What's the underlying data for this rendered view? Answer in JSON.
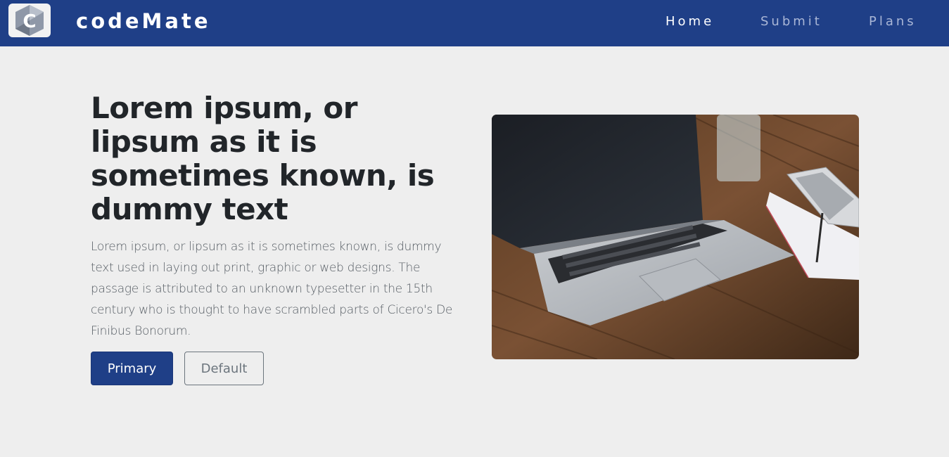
{
  "navbar": {
    "logo_letter": "C",
    "brand": "codeMate",
    "links": [
      {
        "label": "Home"
      },
      {
        "label": "Submit"
      },
      {
        "label": "Plans"
      }
    ]
  },
  "hero": {
    "headline": "Lorem ipsum, or lipsum as it is sometimes known, is dummy text",
    "lead": "Lorem ipsum, or lipsum as it is sometimes known, is dummy text used in laying out print, graphic or web designs. The passage is attributed to an unknown typesetter in the 15th century who is thought to have scrambled parts of Cicero's De Finibus Bonorum.",
    "primary_button": "Primary",
    "default_button": "Default"
  },
  "colors": {
    "navbar": "#1f3f87",
    "background": "#eeeeee",
    "primary": "#1f3f87"
  }
}
